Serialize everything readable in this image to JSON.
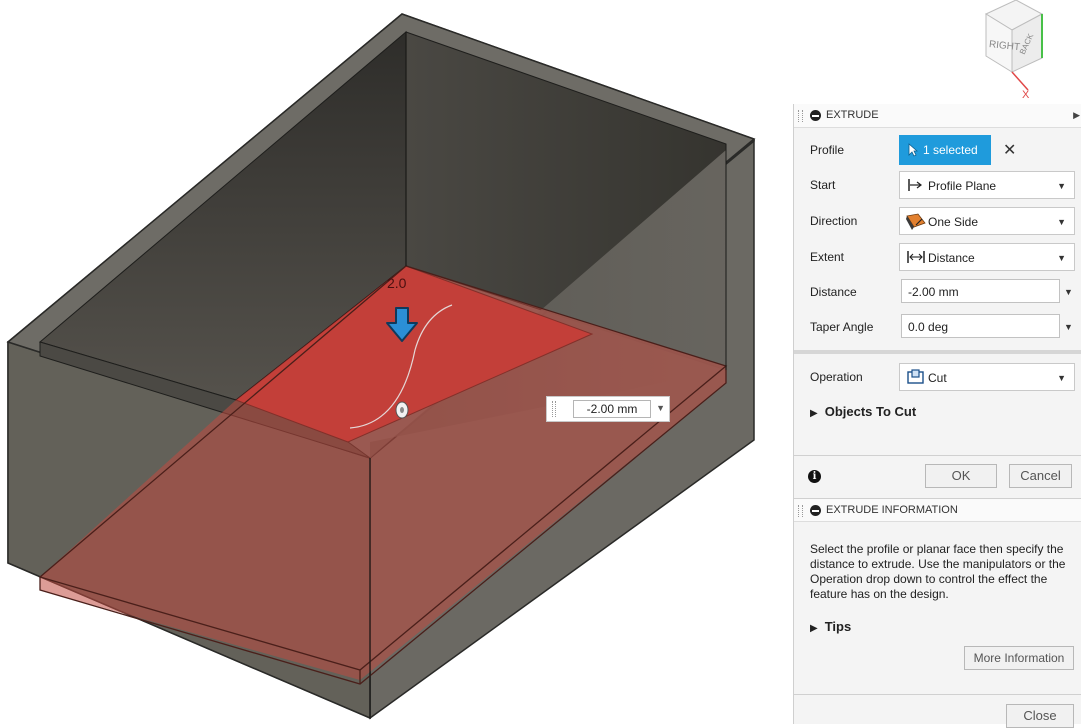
{
  "viewport": {
    "dimension_label": "2.0",
    "value_box": "-2.00 mm"
  },
  "viewcube": {
    "face_right": "RIGHT",
    "face_back": "BACK",
    "axis_x": "X"
  },
  "extrude": {
    "title": "EXTRUDE",
    "rows": {
      "profile": {
        "label": "Profile",
        "value": "1 selected"
      },
      "start": {
        "label": "Start",
        "value": "Profile Plane"
      },
      "direction": {
        "label": "Direction",
        "value": "One Side"
      },
      "extent": {
        "label": "Extent",
        "value": "Distance"
      },
      "distance": {
        "label": "Distance",
        "value": "-2.00 mm"
      },
      "taper": {
        "label": "Taper Angle",
        "value": "0.0 deg"
      },
      "operation": {
        "label": "Operation",
        "value": "Cut"
      }
    },
    "objects_to_cut": "Objects To Cut",
    "ok_label": "OK",
    "cancel_label": "Cancel"
  },
  "info": {
    "title": "EXTRUDE INFORMATION",
    "text": "Select the profile or planar face then specify the distance to extrude. Use the manipulators or the Operation drop down to control the effect the feature has on the design.",
    "tips_label": "Tips",
    "more_label": "More Information",
    "close_label": "Close"
  },
  "colors": {
    "accent": "#1f9bdc",
    "cut_red": "#c83232",
    "body_gray": "#63605a"
  }
}
